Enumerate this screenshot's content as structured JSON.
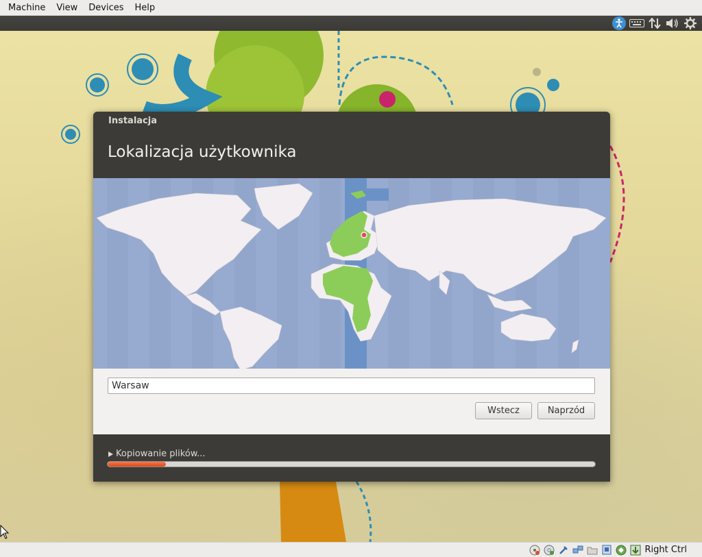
{
  "host_menu": {
    "items": [
      "Machine",
      "View",
      "Devices",
      "Help"
    ]
  },
  "panel": {
    "icons": [
      "accessibility-icon",
      "keyboard-icon",
      "network-icon",
      "volume-icon",
      "power-gear-icon"
    ]
  },
  "installer": {
    "window_title": "Instalacja",
    "heading": "Lokalizacja użytkownika",
    "location_value": "Warsaw",
    "back_label": "Wstecz",
    "forward_label": "Naprzód",
    "progress_label": "Kopiowanie plików...",
    "progress_fraction": 0.12
  },
  "statusbar": {
    "icons": [
      "hard-disk-icon",
      "optical-disk-icon",
      "usb-icon",
      "network-adapter-icon",
      "shared-folder-icon",
      "display-icon",
      "virtualization-icon",
      "mouse-integration-icon"
    ],
    "host_key": "Right Ctrl"
  },
  "colors": {
    "accent": "#dd4814",
    "map_highlight": "#8ccd5a",
    "panel": "#3c3b37"
  }
}
